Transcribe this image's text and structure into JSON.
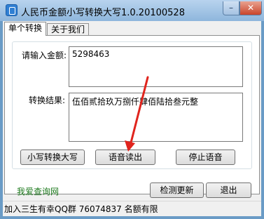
{
  "window": {
    "title": "人民币金额小写转换大写1.0.20100528",
    "minimize_label": "–",
    "close_label": "✕"
  },
  "tabs": [
    {
      "label": "单个转换"
    },
    {
      "label": "关于我们"
    }
  ],
  "input": {
    "label": "请输入金额:",
    "value": "5298463"
  },
  "result": {
    "label": "转换结果:",
    "value": "伍佰贰拾玖万捌仟肆佰陆拾叁元整"
  },
  "buttons": {
    "convert": "小写转换大写",
    "read": "语音读出",
    "stop": "停止语音",
    "check_update": "检测更新",
    "exit": "退出"
  },
  "link": {
    "text": "我爱查询网"
  },
  "status": {
    "text": "加入三生有幸QQ群 76074837 名额有限"
  }
}
